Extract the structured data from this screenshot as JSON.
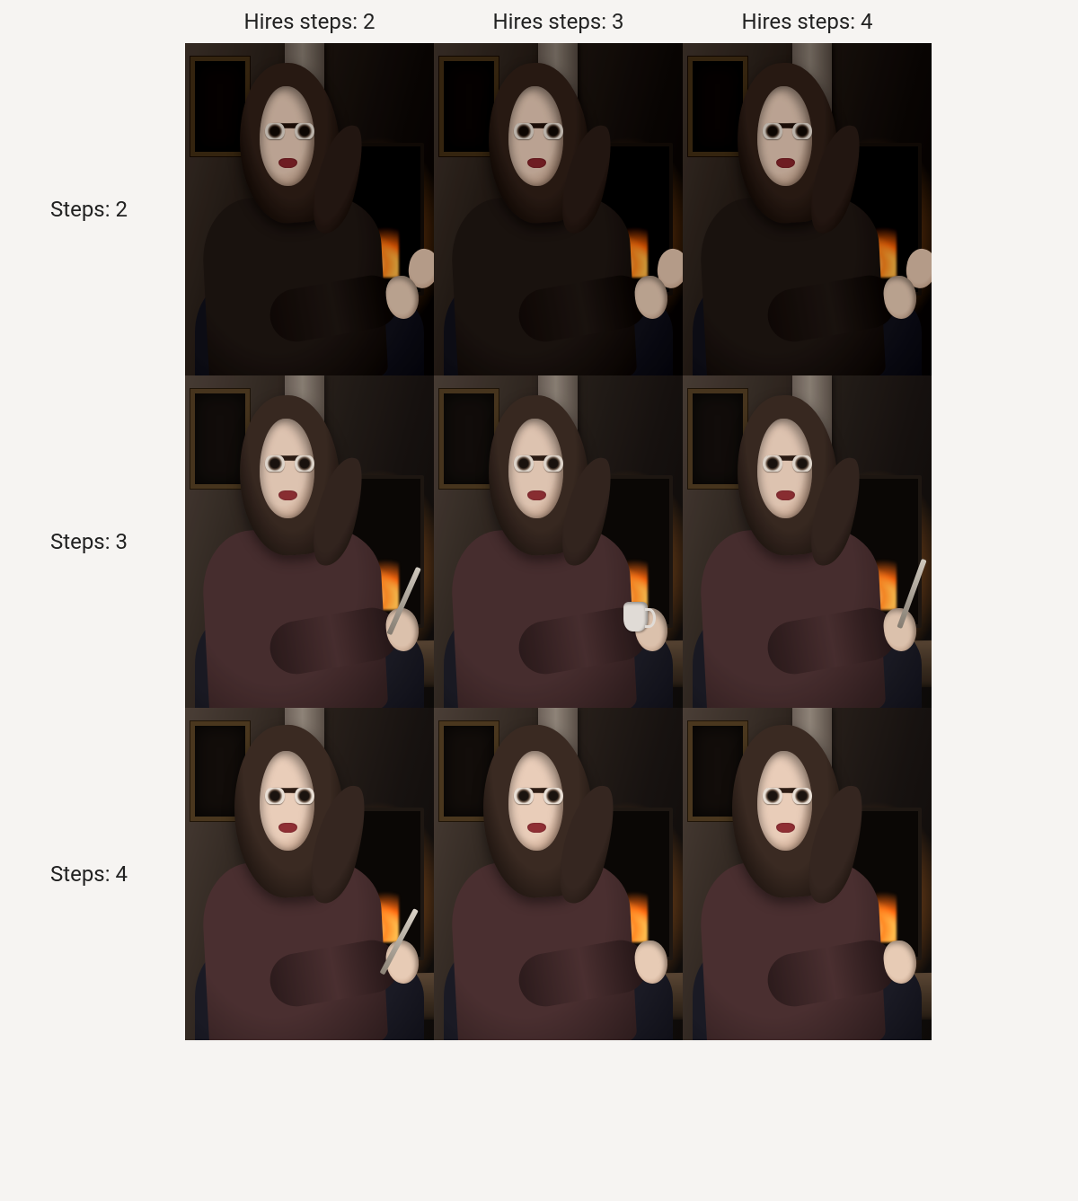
{
  "grid": {
    "column_header_prefix": "Hires steps:",
    "row_header_prefix": "Steps:",
    "columns": [
      "2",
      "3",
      "4"
    ],
    "rows": [
      "2",
      "3",
      "4"
    ]
  },
  "headers": {
    "col1": "Hires steps: 2",
    "col2": "Hires steps: 3",
    "col3": "Hires steps: 4",
    "row1": "Steps: 2",
    "row2": "Steps: 3",
    "row3": "Steps: 4"
  },
  "cells": [
    {
      "row": "2",
      "col": "2",
      "sweater": "dark",
      "holding": "clasped"
    },
    {
      "row": "2",
      "col": "3",
      "sweater": "dark",
      "holding": "clasped"
    },
    {
      "row": "2",
      "col": "4",
      "sweater": "dark",
      "holding": "clasped"
    },
    {
      "row": "3",
      "col": "2",
      "sweater": "plum",
      "holding": "pen"
    },
    {
      "row": "3",
      "col": "3",
      "sweater": "plum",
      "holding": "cup"
    },
    {
      "row": "3",
      "col": "4",
      "sweater": "plum",
      "holding": "pen"
    },
    {
      "row": "4",
      "col": "2",
      "sweater": "plum",
      "holding": "pen"
    },
    {
      "row": "4",
      "col": "3",
      "sweater": "plum",
      "holding": "rest"
    },
    {
      "row": "4",
      "col": "4",
      "sweater": "plum",
      "holding": "rest"
    }
  ]
}
